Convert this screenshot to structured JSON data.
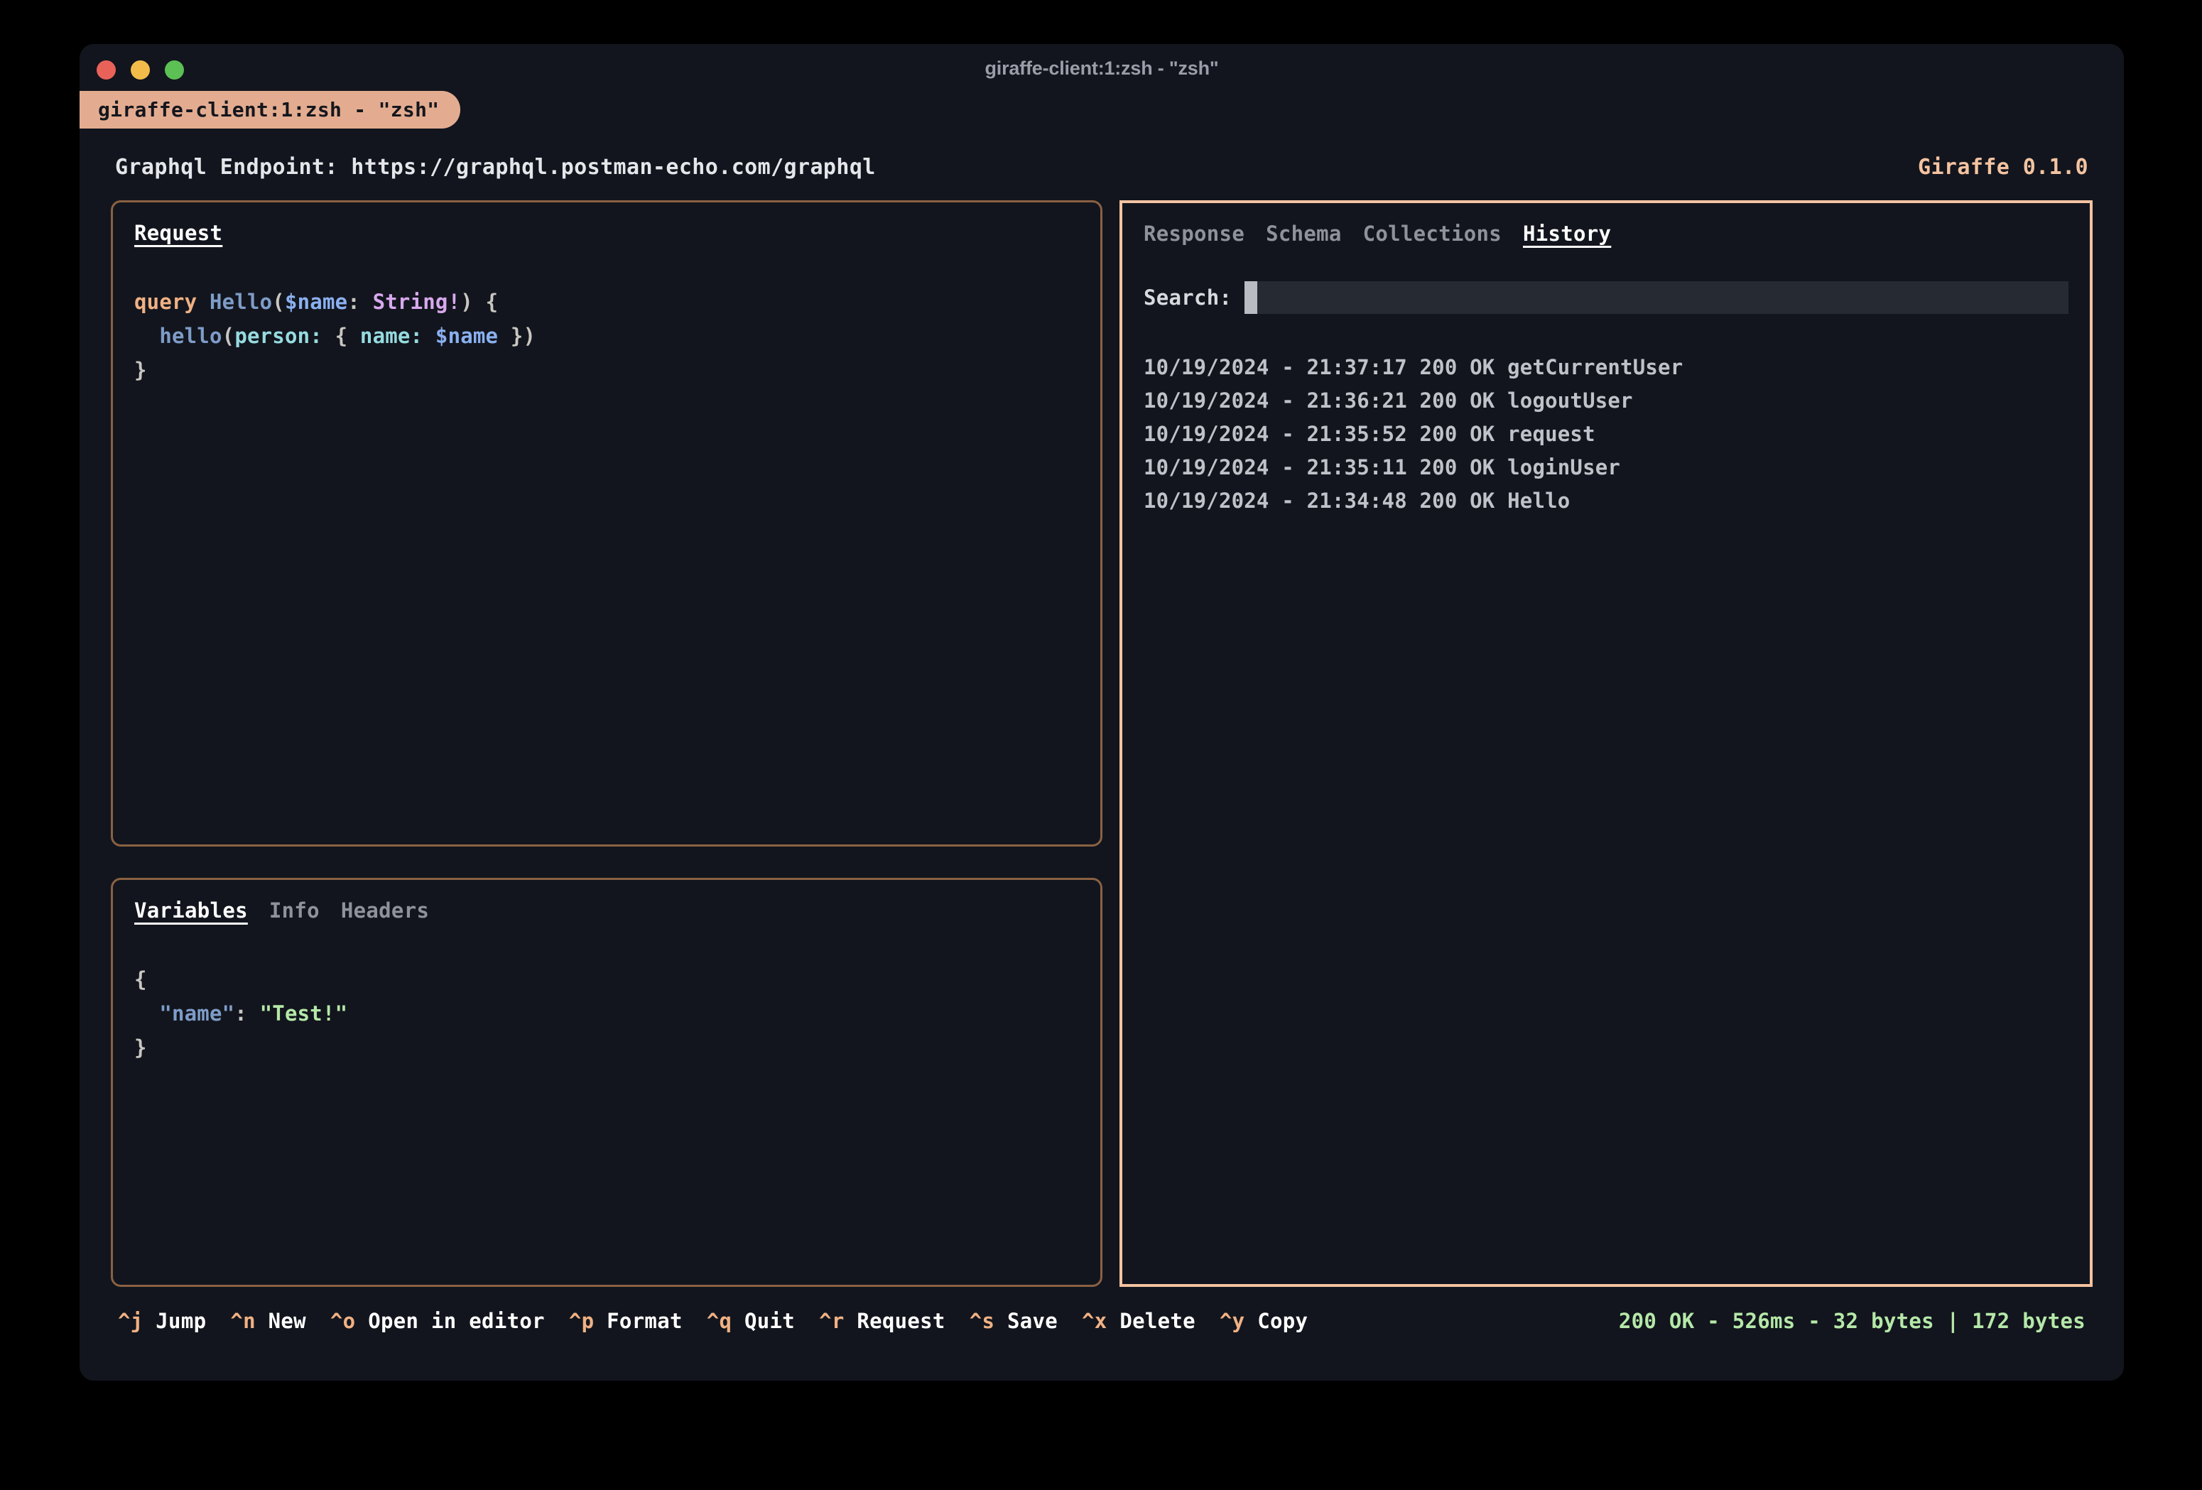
{
  "window": {
    "title": "giraffe-client:1:zsh - \"zsh\"",
    "tab_label": "giraffe-client:1:zsh - \"zsh\""
  },
  "header": {
    "endpoint": "Graphql Endpoint: https://graphql.postman-echo.com/graphql",
    "version": "Giraffe 0.1.0"
  },
  "request_panel": {
    "tab_label": "Request",
    "query": {
      "line1": {
        "kw": "query",
        "space1": " ",
        "opname": "Hello",
        "paren_open": "(",
        "var": "$name",
        "colon": ": ",
        "type": "String!",
        "paren_close": ")",
        "brace": " {"
      },
      "line2": {
        "indent": "  ",
        "field": "hello",
        "paren_open": "(",
        "arg1": "person:",
        "brace_open": " { ",
        "arg2": "name:",
        "space": " ",
        "var": "$name",
        "brace_close": " }",
        "paren_close": ")"
      },
      "line3": "}"
    }
  },
  "variables_panel": {
    "tabs": [
      {
        "label": "Variables",
        "active": true
      },
      {
        "label": "Info",
        "active": false
      },
      {
        "label": "Headers",
        "active": false
      }
    ],
    "json": {
      "line1": "{",
      "indent": "  ",
      "key": "\"name\"",
      "colon": ": ",
      "value": "\"Test!\"",
      "line3": "}"
    }
  },
  "right_panel": {
    "tabs": [
      {
        "label": "Response",
        "active": false
      },
      {
        "label": "Schema",
        "active": false
      },
      {
        "label": "Collections",
        "active": false
      },
      {
        "label": "History",
        "active": true
      }
    ],
    "search": {
      "label": "Search:",
      "value": "",
      "placeholder": ""
    },
    "history": [
      "10/19/2024 - 21:37:17 200 OK getCurrentUser",
      "10/19/2024 - 21:36:21 200 OK logoutUser",
      "10/19/2024 - 21:35:52 200 OK request",
      "10/19/2024 - 21:35:11 200 OK loginUser",
      "10/19/2024 - 21:34:48 200 OK Hello"
    ]
  },
  "statusbar": {
    "shortcuts": [
      {
        "key": "^j",
        "label": "Jump"
      },
      {
        "key": "^n",
        "label": "New"
      },
      {
        "key": "^o",
        "label": "Open in editor"
      },
      {
        "key": "^p",
        "label": "Format"
      },
      {
        "key": "^q",
        "label": "Quit"
      },
      {
        "key": "^r",
        "label": "Request"
      },
      {
        "key": "^s",
        "label": "Save"
      },
      {
        "key": "^x",
        "label": "Delete"
      },
      {
        "key": "^y",
        "label": "Copy"
      }
    ],
    "response_stats": "200 OK - 526ms - 32 bytes | 172 bytes"
  },
  "colors": {
    "accent": "#f4c3a1",
    "tab_bg": "#e3ac90",
    "panel_border_dim": "#8a6143",
    "terminal_bg": "#12151d",
    "success_green": "#b5e8a8",
    "traffic_red": "#e9625a",
    "traffic_yellow": "#f3bc4a",
    "traffic_green": "#5cc055"
  }
}
